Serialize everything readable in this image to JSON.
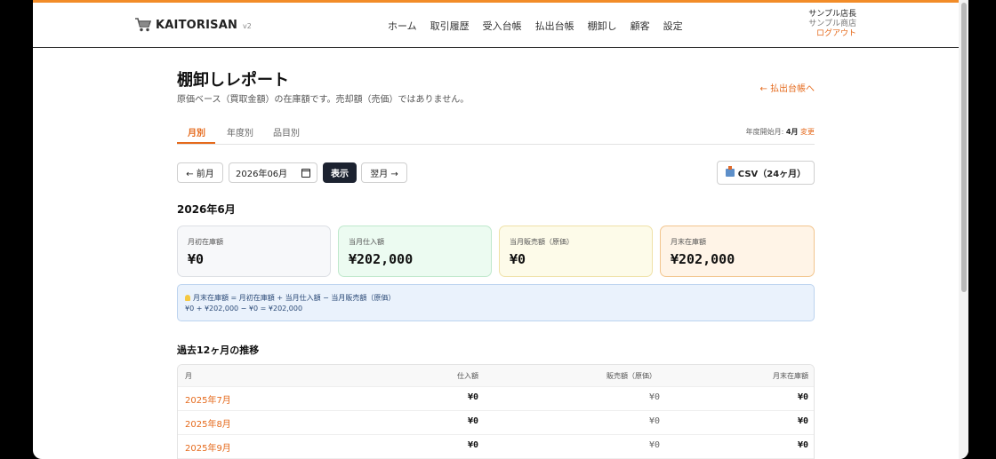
{
  "app": {
    "name": "KAITORISAN",
    "version": "v2"
  },
  "nav": [
    "ホーム",
    "取引履歴",
    "受入台帳",
    "払出台帳",
    "棚卸し",
    "顧客",
    "設定"
  ],
  "user": {
    "name": "サンプル店長",
    "shop": "サンプル商店",
    "logout": "ログアウト"
  },
  "page": {
    "title": "棚卸しレポート",
    "subtitle": "原価ベース（買取金額）の在庫額です。売却額（売価）ではありません。",
    "back_link": "← 払出台帳へ"
  },
  "tabs": [
    "月別",
    "年度別",
    "品目別"
  ],
  "fiscal": {
    "label": "年度開始月:",
    "value": "4月",
    "change": "変更"
  },
  "controls": {
    "prev": "← 前月",
    "date_value": "2026年06月",
    "show": "表示",
    "next": "翌月 →",
    "csv": "CSV（24ヶ月）"
  },
  "month_heading": "2026年6月",
  "cards": [
    {
      "label": "月初在庫額",
      "value": "¥0"
    },
    {
      "label": "当月仕入額",
      "value": "¥202,000"
    },
    {
      "label": "当月販売額（原価）",
      "value": "¥0"
    },
    {
      "label": "月末在庫額",
      "value": "¥202,000"
    }
  ],
  "formula": {
    "line1": "月末在庫額 = 月初在庫額 + 当月仕入額 − 当月販売額（原価）",
    "line2": "¥0 + ¥202,000 − ¥0 = ¥202,000"
  },
  "trend": {
    "heading": "過去12ヶ月の推移",
    "columns": [
      "月",
      "仕入額",
      "販売額（原価）",
      "月末在庫額"
    ],
    "rows": [
      {
        "month": "2025年7月",
        "purchase": "¥0",
        "sales": "¥0",
        "end": "¥0"
      },
      {
        "month": "2025年8月",
        "purchase": "¥0",
        "sales": "¥0",
        "end": "¥0"
      },
      {
        "month": "2025年9月",
        "purchase": "¥0",
        "sales": "¥0",
        "end": "¥0"
      }
    ]
  },
  "colors": {
    "accent": "#f28c28",
    "link": "#e56a1c",
    "primary_button": "#1c2230"
  }
}
